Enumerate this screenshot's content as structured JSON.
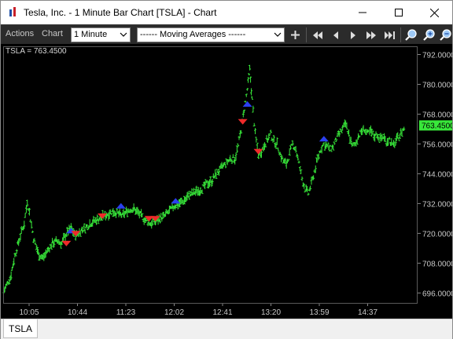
{
  "window": {
    "title": "Tesla, Inc.  - 1 Minute Bar Chart [TSLA] - Chart"
  },
  "toolbar": {
    "actions_label": "Actions",
    "chart_label": "Chart",
    "interval_value": "1 Minute",
    "study_value": "------  Moving Averages  ------",
    "icons": [
      "add-icon",
      "first-icon",
      "step-back-icon",
      "step-forward-icon",
      "last-icon",
      "zoom-icon",
      "zoom-in-icon",
      "zoom-out-icon"
    ]
  },
  "chart": {
    "price_readout": "TSLA = 763.4500",
    "last_price_label": "763.4500",
    "colors": {
      "background": "#000000",
      "bars": "#38e83a",
      "buy_marker": "#2b3ff0",
      "sell_marker": "#ee2a2a",
      "last_price_bg": "#38e83a"
    }
  },
  "chart_data": {
    "type": "ohlc-bar",
    "symbol": "TSLA",
    "interval": "1 Minute",
    "y_ticks": [
      "792.0000",
      "780.0000",
      "768.0000",
      "756.0000",
      "744.0000",
      "732.0000",
      "720.0000",
      "708.0000",
      "696.0000"
    ],
    "ylim": [
      692,
      795
    ],
    "x_ticks": [
      "10:05",
      "10:44",
      "11:23",
      "12:02",
      "12:41",
      "13:20",
      "13:59",
      "14:37"
    ],
    "last_price": 763.45,
    "grid": false,
    "series": [
      {
        "x": 0,
        "y": 697
      },
      {
        "x": 8,
        "y": 702
      },
      {
        "x": 14,
        "y": 711
      },
      {
        "x": 20,
        "y": 718
      },
      {
        "x": 26,
        "y": 724
      },
      {
        "x": 30,
        "y": 733
      },
      {
        "x": 34,
        "y": 726
      },
      {
        "x": 38,
        "y": 718
      },
      {
        "x": 44,
        "y": 712
      },
      {
        "x": 50,
        "y": 710
      },
      {
        "x": 56,
        "y": 713
      },
      {
        "x": 62,
        "y": 716
      },
      {
        "x": 68,
        "y": 717
      },
      {
        "x": 74,
        "y": 716
      },
      {
        "x": 80,
        "y": 720
      },
      {
        "x": 86,
        "y": 722
      },
      {
        "x": 92,
        "y": 719
      },
      {
        "x": 98,
        "y": 721
      },
      {
        "x": 104,
        "y": 722
      },
      {
        "x": 110,
        "y": 724
      },
      {
        "x": 116,
        "y": 725
      },
      {
        "x": 122,
        "y": 726
      },
      {
        "x": 128,
        "y": 727
      },
      {
        "x": 134,
        "y": 728
      },
      {
        "x": 140,
        "y": 729
      },
      {
        "x": 146,
        "y": 728
      },
      {
        "x": 152,
        "y": 727
      },
      {
        "x": 158,
        "y": 729
      },
      {
        "x": 164,
        "y": 730
      },
      {
        "x": 170,
        "y": 729
      },
      {
        "x": 176,
        "y": 727
      },
      {
        "x": 182,
        "y": 725
      },
      {
        "x": 188,
        "y": 724
      },
      {
        "x": 194,
        "y": 725
      },
      {
        "x": 200,
        "y": 726
      },
      {
        "x": 206,
        "y": 727
      },
      {
        "x": 212,
        "y": 729
      },
      {
        "x": 218,
        "y": 731
      },
      {
        "x": 224,
        "y": 732
      },
      {
        "x": 230,
        "y": 733
      },
      {
        "x": 236,
        "y": 735
      },
      {
        "x": 242,
        "y": 736
      },
      {
        "x": 248,
        "y": 737
      },
      {
        "x": 254,
        "y": 738
      },
      {
        "x": 260,
        "y": 740
      },
      {
        "x": 266,
        "y": 741
      },
      {
        "x": 272,
        "y": 744
      },
      {
        "x": 278,
        "y": 746
      },
      {
        "x": 284,
        "y": 748
      },
      {
        "x": 290,
        "y": 750
      },
      {
        "x": 296,
        "y": 750
      },
      {
        "x": 300,
        "y": 755
      },
      {
        "x": 304,
        "y": 762
      },
      {
        "x": 308,
        "y": 770
      },
      {
        "x": 312,
        "y": 778
      },
      {
        "x": 315,
        "y": 786
      },
      {
        "x": 318,
        "y": 774
      },
      {
        "x": 322,
        "y": 760
      },
      {
        "x": 326,
        "y": 752
      },
      {
        "x": 330,
        "y": 753
      },
      {
        "x": 334,
        "y": 756
      },
      {
        "x": 338,
        "y": 758
      },
      {
        "x": 342,
        "y": 760
      },
      {
        "x": 346,
        "y": 757
      },
      {
        "x": 350,
        "y": 756
      },
      {
        "x": 354,
        "y": 752
      },
      {
        "x": 358,
        "y": 749
      },
      {
        "x": 362,
        "y": 748
      },
      {
        "x": 366,
        "y": 752
      },
      {
        "x": 370,
        "y": 756
      },
      {
        "x": 374,
        "y": 754
      },
      {
        "x": 378,
        "y": 748
      },
      {
        "x": 382,
        "y": 742
      },
      {
        "x": 386,
        "y": 738
      },
      {
        "x": 390,
        "y": 736
      },
      {
        "x": 394,
        "y": 740
      },
      {
        "x": 398,
        "y": 745
      },
      {
        "x": 402,
        "y": 750
      },
      {
        "x": 406,
        "y": 754
      },
      {
        "x": 410,
        "y": 756
      },
      {
        "x": 414,
        "y": 755
      },
      {
        "x": 418,
        "y": 754
      },
      {
        "x": 422,
        "y": 755
      },
      {
        "x": 426,
        "y": 758
      },
      {
        "x": 430,
        "y": 760
      },
      {
        "x": 434,
        "y": 762
      },
      {
        "x": 438,
        "y": 764
      },
      {
        "x": 442,
        "y": 760
      },
      {
        "x": 446,
        "y": 755
      },
      {
        "x": 450,
        "y": 756
      },
      {
        "x": 454,
        "y": 759
      },
      {
        "x": 458,
        "y": 761
      },
      {
        "x": 462,
        "y": 762
      },
      {
        "x": 466,
        "y": 760
      },
      {
        "x": 470,
        "y": 761
      },
      {
        "x": 474,
        "y": 759
      },
      {
        "x": 478,
        "y": 760
      },
      {
        "x": 482,
        "y": 758
      },
      {
        "x": 486,
        "y": 759
      },
      {
        "x": 490,
        "y": 757
      },
      {
        "x": 494,
        "y": 758
      },
      {
        "x": 498,
        "y": 755
      },
      {
        "x": 502,
        "y": 757
      },
      {
        "x": 506,
        "y": 759
      },
      {
        "x": 510,
        "y": 761
      },
      {
        "x": 514,
        "y": 763
      }
    ],
    "buy_markers": [
      {
        "x": 86,
        "y": 720
      },
      {
        "x": 150,
        "y": 730
      },
      {
        "x": 220,
        "y": 732
      },
      {
        "x": 312,
        "y": 771
      },
      {
        "x": 410,
        "y": 757
      }
    ],
    "sell_markers": [
      {
        "x": 80,
        "y": 717
      },
      {
        "x": 92,
        "y": 721
      },
      {
        "x": 126,
        "y": 728
      },
      {
        "x": 186,
        "y": 727
      },
      {
        "x": 194,
        "y": 727
      },
      {
        "x": 306,
        "y": 766
      },
      {
        "x": 326,
        "y": 754
      }
    ]
  },
  "tabs": {
    "symbol_tab": "TSLA"
  }
}
